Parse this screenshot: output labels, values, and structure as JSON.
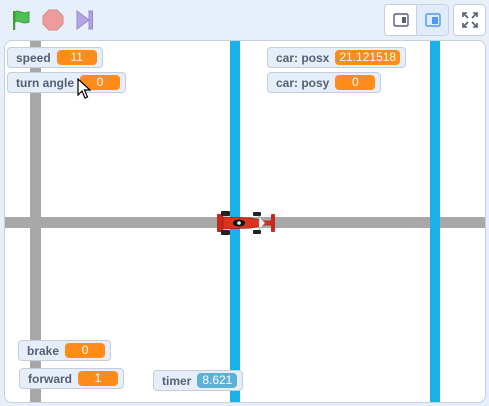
{
  "toolbar": {
    "icons": [
      "green-flag-icon",
      "stop-icon",
      "skip-icon"
    ],
    "buttons": [
      "small-stage-button",
      "normal-stage-button",
      "fullscreen-button"
    ]
  },
  "colors": {
    "variable_orange": "#ff8c1a",
    "sensing_blue": "#5cb1d6",
    "lane_blue": "#1ab0e9",
    "road_gray": "#a8a8a8"
  },
  "monitors": {
    "speed": {
      "label": "speed",
      "value": "11"
    },
    "turn_angle": {
      "label": "turn angle",
      "value": "0"
    },
    "car_posx": {
      "label": "car: posx",
      "value": "21.121518"
    },
    "car_posy": {
      "label": "car: posy",
      "value": "0"
    },
    "brake": {
      "label": "brake",
      "value": "0"
    },
    "forward": {
      "label": "forward",
      "value": "1"
    },
    "timer": {
      "label": "timer",
      "value": "8.621"
    }
  }
}
